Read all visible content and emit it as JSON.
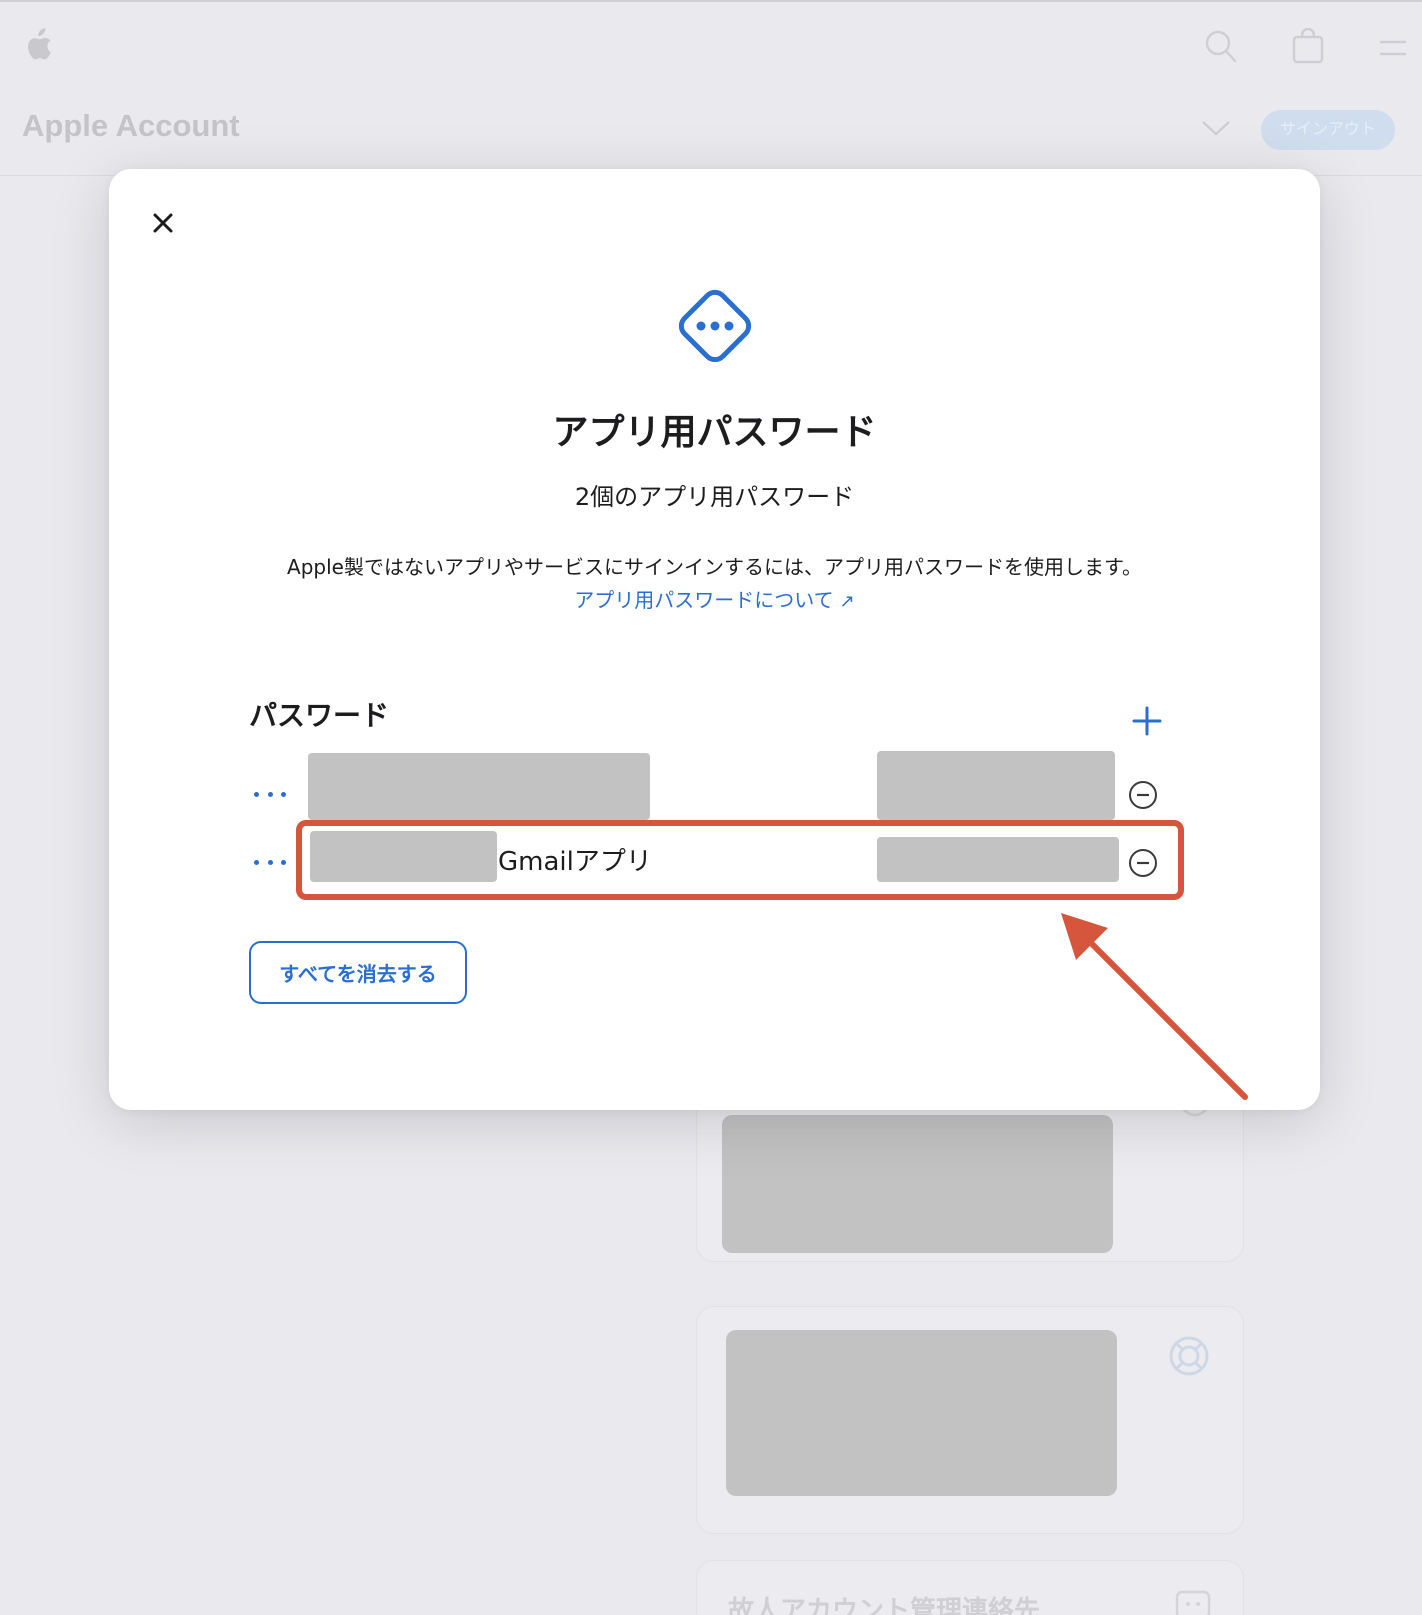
{
  "header": {
    "section_title": "Apple Account",
    "signout_label": "サインアウト",
    "icons": [
      "apple-logo-icon",
      "search-icon",
      "bag-icon",
      "menu-icon",
      "chevron-down-icon"
    ]
  },
  "background": {
    "card_text": "故人アカウント管理連絡先",
    "icons": [
      "shield-icon",
      "lifebuoy-icon",
      "contact-icon"
    ]
  },
  "modal": {
    "title": "アプリ用パスワード",
    "count_text": "2個のアプリ用パスワード",
    "description": "Apple製ではないアプリやサービスにサインインするには、アプリ用パスワードを使用します。",
    "link_label": "アプリ用パスワードについて",
    "link_arrow": "↗",
    "section_title": "パスワード",
    "passwords": [
      {
        "name": "",
        "redacted": true
      },
      {
        "name": "Gmailアプリ",
        "redacted_prefix": true,
        "highlighted": true
      }
    ],
    "clear_all_label": "すべてを消去する",
    "icons": [
      "close-icon",
      "passwords-icon",
      "plus-icon",
      "more-icon",
      "minus-circle-icon"
    ]
  },
  "colors": {
    "accent": "#2a6fd0",
    "annotation": "#d5563c",
    "redaction": "#c2c2c2",
    "backdrop": "#e9e9ee"
  }
}
